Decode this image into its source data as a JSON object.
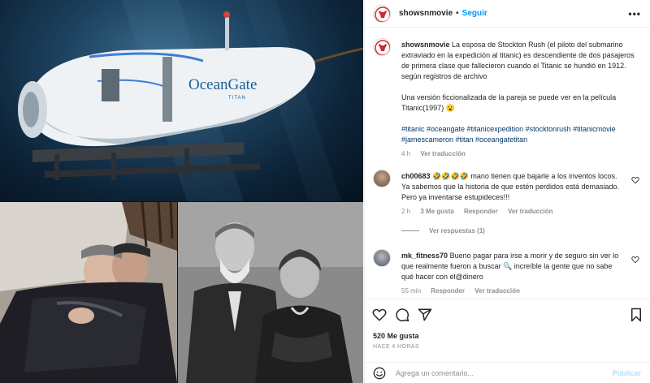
{
  "post": {
    "username": "showsnmovie",
    "follow_label": "Seguir",
    "separator": "•",
    "more_label": "•••",
    "submarine_logo": "OceanGate",
    "submarine_sub": "TITAN"
  },
  "caption": {
    "username": "showsnmovie",
    "text": "La esposa de Stockton Rush (el piloto del submarino extraviado en la expedición al titanic) es descendiente de dos pasajeros de primera clase que fallecieron cuando el Titanic se hundió en 1912. según registros de archivo",
    "text2": "Una versión ficcionalizada de la pareja se puede ver en la película Titanic(1997) 😮",
    "hashtags": "#titanic #oceangate #titanicexpedition #stocktonrush #titanicmovie #jamescameron #titan #oceangatetitan",
    "age": "4 h",
    "translate": "Ver traducción"
  },
  "comments": [
    {
      "username": "ch00683",
      "text": "🤣🤣🤣🤣 mano tienen que bajarle a los inventos locos. Ya sabemos que la historia de que estén perdidos está demasiado. Pero ya inventarse estupideces!!!",
      "age": "2 h",
      "likes": "3 Me gusta",
      "reply": "Responder",
      "translate": "Ver traducción"
    },
    {
      "username": "mk_fitness70",
      "text": "Bueno pagar para irse a morir y de seguro sin ver lo que realmente fueron a buscar 🔍 increíble la gente que no sabe qué hacer con el@dinero",
      "age": "55 min",
      "reply": "Responder",
      "translate": "Ver traducción"
    }
  ],
  "view_replies": "Ver respuestas (1)",
  "stats": {
    "likes": "520 Me gusta",
    "time": "HACE 4 HORAS"
  },
  "comment_box": {
    "placeholder": "Agrega un comentario...",
    "publish": "Publicar"
  },
  "icons": {
    "like": "heart-icon",
    "comment": "comment-icon",
    "share": "share-icon",
    "save": "bookmark-icon",
    "emoji": "emoji-icon",
    "more": "more-icon"
  },
  "colors": {
    "link": "#0095f6",
    "hashtag": "#00376b",
    "muted": "#8e8e8e",
    "publish_disabled": "#b2dffc"
  }
}
